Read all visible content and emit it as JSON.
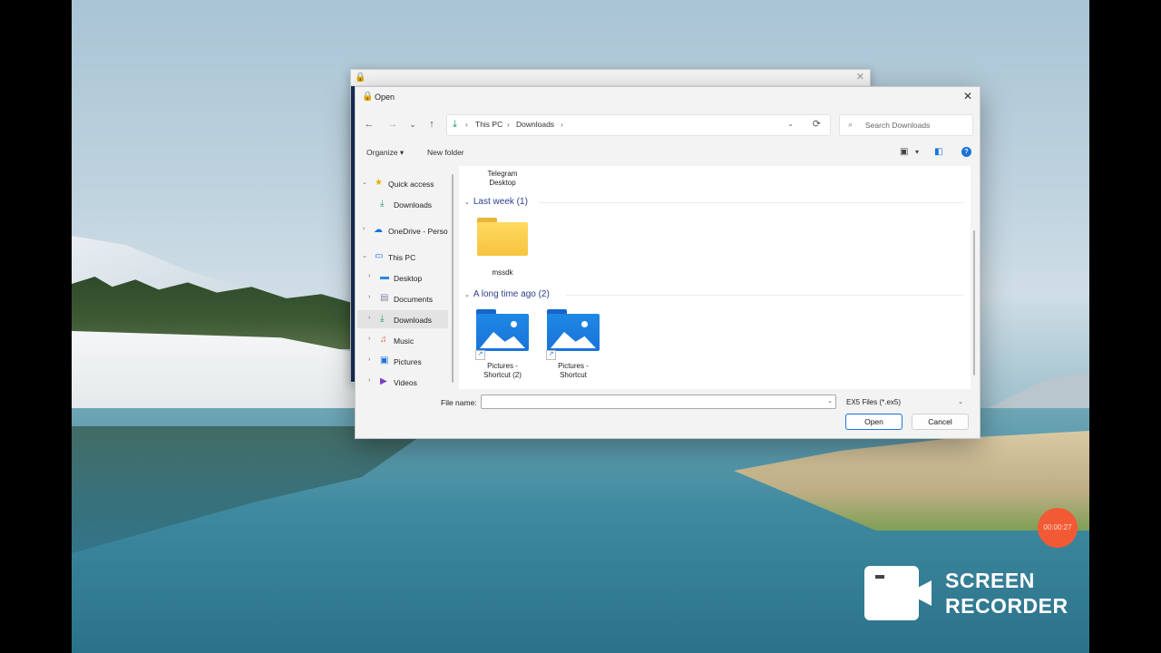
{
  "dialog": {
    "title": "Open",
    "close_glyph": "✕"
  },
  "nav_buttons": {
    "back": "←",
    "forward": "→",
    "recent": "⌄",
    "up": "↑"
  },
  "address": {
    "crumbs": [
      "This PC",
      "Downloads"
    ],
    "separator": "›",
    "dropdown_glyph": "⌄",
    "refresh_glyph": "⟳"
  },
  "search": {
    "placeholder": "Search Downloads",
    "icon": "search-icon"
  },
  "toolbar": {
    "organize_label": "Organize ▾",
    "new_folder_label": "New folder",
    "view_icon": "view-icon",
    "view_dropdown": "▾",
    "preview_icon": "preview-pane-icon",
    "help_glyph": "?"
  },
  "sidebar": {
    "items": [
      {
        "label": "Quick access",
        "icon": "star-icon",
        "glyph": "★",
        "color": "#e8b000",
        "expander": "⌄"
      },
      {
        "label": "Downloads",
        "icon": "download-icon",
        "glyph": "⤓",
        "color": "#1a9e52",
        "expander": ""
      },
      {
        "label": "OneDrive - Perso",
        "icon": "cloud-icon",
        "glyph": "☁",
        "color": "#1a73d9",
        "expander": "›"
      },
      {
        "label": "This PC",
        "icon": "computer-icon",
        "glyph": "▭",
        "color": "#1a73d9",
        "expander": "⌄"
      },
      {
        "label": "Desktop",
        "icon": "desktop-icon",
        "glyph": "▬",
        "color": "#2a8ae6",
        "expander": "›"
      },
      {
        "label": "Documents",
        "icon": "documents-icon",
        "glyph": "▤",
        "color": "#7a8aa0",
        "expander": "›"
      },
      {
        "label": "Downloads",
        "icon": "download-icon",
        "glyph": "⤓",
        "color": "#1a9e52",
        "expander": "›"
      },
      {
        "label": "Music",
        "icon": "music-icon",
        "glyph": "♫",
        "color": "#e0533d",
        "expander": "›"
      },
      {
        "label": "Pictures",
        "icon": "pictures-icon",
        "glyph": "▣",
        "color": "#1a73d9",
        "expander": "›"
      },
      {
        "label": "Videos",
        "icon": "videos-icon",
        "glyph": "▶",
        "color": "#7b3fc4",
        "expander": "›"
      }
    ]
  },
  "content": {
    "top_item_label": [
      "Telegram",
      "Desktop"
    ],
    "groups": [
      {
        "label": "Last week (1)",
        "chevron": "⌄"
      },
      {
        "label": "A long time ago (2)",
        "chevron": "⌄"
      }
    ],
    "files": [
      {
        "name": "mssdk",
        "icon": "folder-icon"
      },
      {
        "name_lines": [
          "Pictures -",
          "Shortcut (2)"
        ],
        "icon": "pictures-folder-icon"
      },
      {
        "name_lines": [
          "Pictures -",
          "Shortcut"
        ],
        "icon": "pictures-folder-icon"
      }
    ],
    "shortcut_glyph": "↗"
  },
  "footer": {
    "file_name_label": "File name:",
    "file_name_value": "",
    "file_type_value": "EX5 Files (*.ex5)",
    "dropdown_glyph": "⌄",
    "open_label": "Open",
    "cancel_label": "Cancel"
  },
  "recorder": {
    "timer": "00:00:27",
    "logo_text_line1": "SCREEN",
    "logo_text_line2": "RECORDER"
  },
  "colors": {
    "accent": "#1a73d9",
    "folder_yellow": "#f6c43f",
    "recording_badge": "#f25a35"
  }
}
